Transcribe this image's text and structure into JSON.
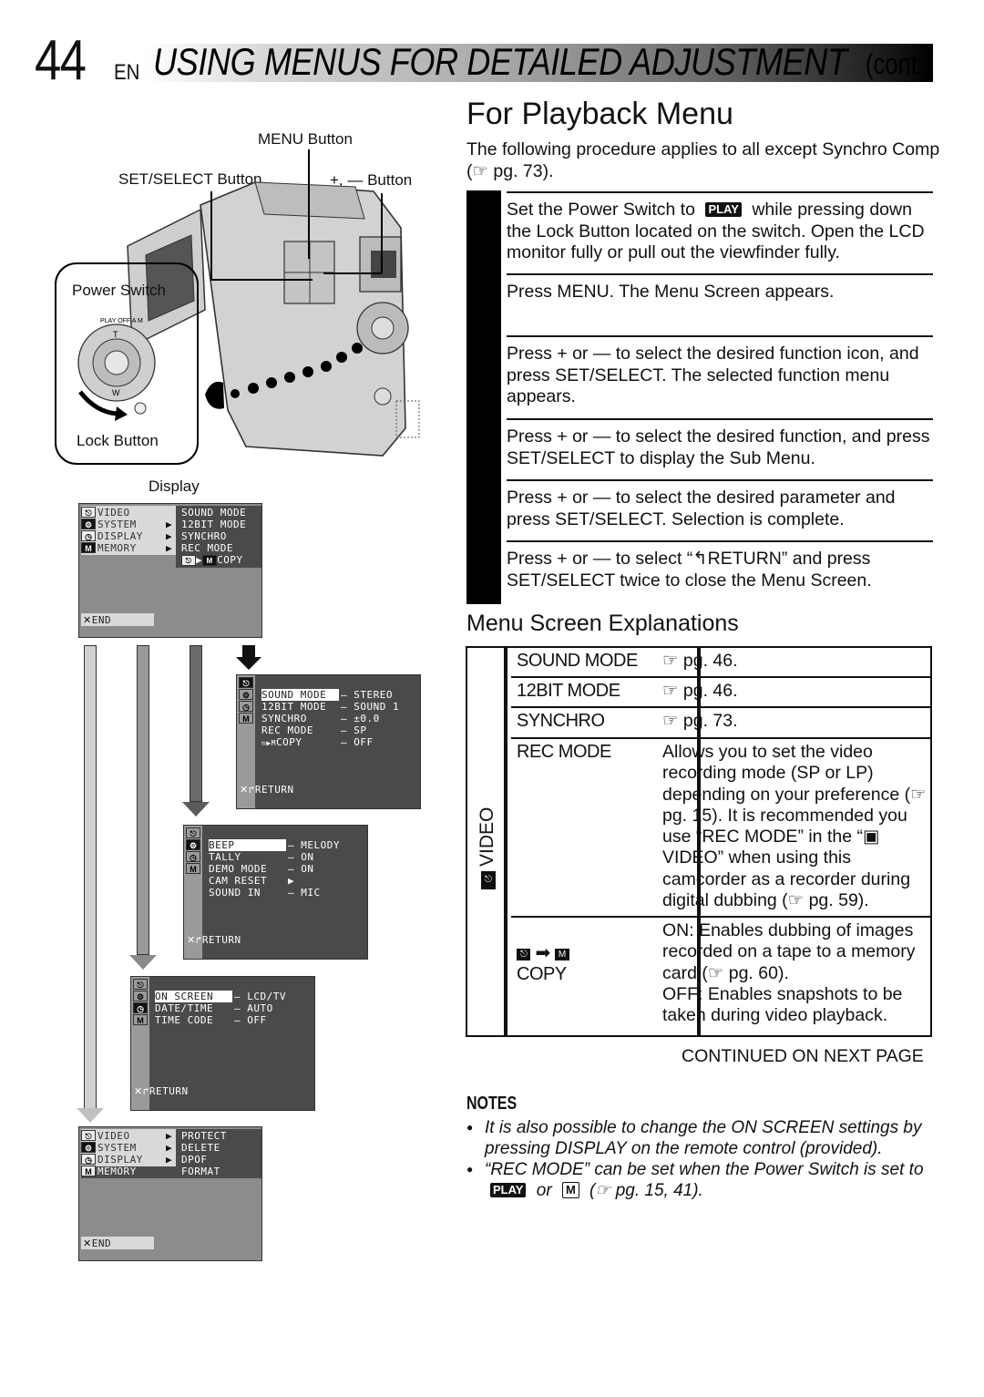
{
  "header": {
    "page_number": "44",
    "lang": "EN",
    "title": "USING MENUS FOR DETAILED ADJUSTMENT",
    "continued": "(cont.)"
  },
  "illustration": {
    "menu_button_label": "MENU Button",
    "set_select_label": "SET/SELECT Button",
    "plus_minus_label": "+, — Button",
    "power_switch_label": "Power Switch",
    "lock_button_label": "Lock Button",
    "switch_positions": [
      "PLAY",
      "OFF",
      "A",
      "M"
    ],
    "dial_top": "T",
    "dial_bottom": "W",
    "display_label": "Display"
  },
  "screens": {
    "main": {
      "left_items": [
        "VIDEO",
        "SYSTEM",
        "DISPLAY",
        "MEMORY"
      ],
      "right_items": [
        "SOUND MODE",
        "12BIT MODE",
        "SYNCHRO",
        "REC MODE",
        "COPY"
      ],
      "end_label": "END"
    },
    "video_sub": {
      "rows": [
        {
          "name": "SOUND MODE",
          "value": "STEREO"
        },
        {
          "name": "12BIT MODE",
          "value": "SOUND 1"
        },
        {
          "name": "SYNCHRO",
          "value": "±0.0"
        },
        {
          "name": "REC MODE",
          "value": "SP"
        },
        {
          "name": "COPY",
          "value": "OFF"
        }
      ],
      "return_label": "RETURN"
    },
    "system_sub": {
      "rows": [
        {
          "name": "BEEP",
          "value": "MELODY"
        },
        {
          "name": "TALLY",
          "value": "ON"
        },
        {
          "name": "DEMO MODE",
          "value": "ON"
        },
        {
          "name": "CAM RESET",
          "value": "▶"
        },
        {
          "name": "SOUND IN",
          "value": "MIC"
        }
      ],
      "return_label": "RETURN"
    },
    "display_sub": {
      "rows": [
        {
          "name": "ON SCREEN",
          "value": "LCD/TV"
        },
        {
          "name": "DATE/TIME",
          "value": "AUTO"
        },
        {
          "name": "TIME CODE",
          "value": "OFF"
        }
      ],
      "return_label": "RETURN"
    },
    "memory": {
      "left_items": [
        "VIDEO",
        "SYSTEM",
        "DISPLAY",
        "MEMORY"
      ],
      "right_items": [
        "PROTECT",
        "DELETE",
        "DPOF",
        "FORMAT"
      ],
      "end_label": "END"
    }
  },
  "playback": {
    "title": "For Playback Menu",
    "intro": "The following procedure applies to all except Synchro Comp (☞ pg. 73).",
    "steps": [
      {
        "pre": "Set the Power Switch to ",
        "badge": "PLAY",
        "post": " while pressing down the Lock Button located on the switch. Open the LCD monitor fully or pull out the viewfinder fully."
      },
      {
        "text": "Press MENU. The Menu Screen appears."
      },
      {
        "text": "Press + or — to select the desired function icon, and press SET/SELECT. The selected function menu appears."
      },
      {
        "text": "Press + or — to select the desired function, and press SET/SELECT to display the Sub Menu."
      },
      {
        "text": "Press + or — to select the desired parameter and press SET/SELECT. Selection is complete."
      },
      {
        "text": "Press + or — to select “↰RETURN” and press SET/SELECT twice to close the Menu Screen."
      }
    ]
  },
  "explanations": {
    "title": "Menu Screen Explanations",
    "group_label": "VIDEO",
    "rows": [
      {
        "name": "SOUND MODE",
        "desc": "☞ pg. 46."
      },
      {
        "name": "12BIT MODE",
        "desc": "☞ pg. 46."
      },
      {
        "name": "SYNCHRO",
        "desc": "☞ pg. 73."
      },
      {
        "name": "REC MODE",
        "desc": "Allows you to set the video recording mode (SP or LP) depending on your preference (☞ pg. 15). It is recommended you use “REC MODE” in the “▣ VIDEO” when using this camcorder as a recorder during digital dubbing (☞ pg. 59)."
      },
      {
        "name": "COPY",
        "desc_on": "ON: Enables dubbing of images recorded on a tape to a memory card (☞ pg. 60).",
        "desc_off": "OFF: Enables snapshots to be taken during video playback."
      }
    ],
    "continued": "CONTINUED ON NEXT PAGE"
  },
  "notes": {
    "title": "NOTES",
    "items": [
      {
        "text": "It is also possible to change the ON SCREEN settings by pressing DISPLAY on the remote control (provided)."
      },
      {
        "pre": "“REC MODE” can be set when the Power Switch is set to ",
        "badge1": "PLAY",
        "mid": " or ",
        "badge2": "M",
        "post": " (☞ pg. 15, 41)."
      }
    ]
  }
}
